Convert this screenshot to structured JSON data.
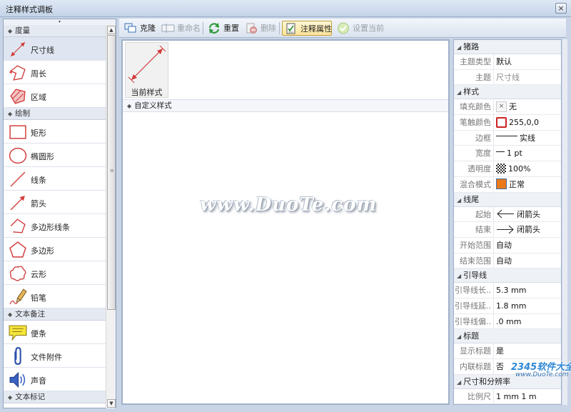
{
  "window": {
    "title": "注释样式调板",
    "close_glyph": "×"
  },
  "left_panel": {
    "groups": [
      {
        "label": "度量",
        "items": [
          {
            "label": "尺寸线",
            "icon": "dimension-line-icon",
            "selected": true
          },
          {
            "label": "周长",
            "icon": "perimeter-icon"
          },
          {
            "label": "区域",
            "icon": "area-icon"
          }
        ]
      },
      {
        "label": "绘制",
        "items": [
          {
            "label": "矩形",
            "icon": "rectangle-icon"
          },
          {
            "label": "椭圆形",
            "icon": "ellipse-icon"
          },
          {
            "label": "线条",
            "icon": "line-icon"
          },
          {
            "label": "箭头",
            "icon": "arrow-icon"
          },
          {
            "label": "多边形线条",
            "icon": "polyline-icon"
          },
          {
            "label": "多边形",
            "icon": "polygon-icon"
          },
          {
            "label": "云形",
            "icon": "cloud-icon"
          },
          {
            "label": "铅笔",
            "icon": "pencil-icon"
          }
        ]
      },
      {
        "label": "文本备注",
        "items": [
          {
            "label": "便条",
            "icon": "sticky-note-icon"
          },
          {
            "label": "文件附件",
            "icon": "paperclip-icon"
          },
          {
            "label": "声音",
            "icon": "speaker-icon"
          }
        ]
      },
      {
        "label": "文本标记",
        "items": []
      }
    ]
  },
  "toolbar": {
    "clone": "克隆",
    "rename": "重命名",
    "reset": "重置",
    "delete": "删除",
    "annotation_props": "注释属性",
    "set_current": "设置当前"
  },
  "center": {
    "current_style_label": "当前样式",
    "custom_styles_header": "自定义样式",
    "watermark": "www.DuoTe.com"
  },
  "properties": {
    "sections": [
      {
        "label": "猪路",
        "rows": [
          {
            "key": "主题类型",
            "value": "默认"
          },
          {
            "key": "主题",
            "value": "尺寸线",
            "gray": true
          }
        ]
      },
      {
        "label": "样式",
        "rows": [
          {
            "key": "填充颜色",
            "value": "无",
            "swatch": "none"
          },
          {
            "key": "笔触颜色",
            "value": "255,0,0",
            "swatch": "#cc2222"
          },
          {
            "key": "边框",
            "value": "实线",
            "swatch": "solid-line"
          },
          {
            "key": "宽度",
            "value": "1 pt",
            "swatch": "thin-line"
          },
          {
            "key": "透明度",
            "value": "100%",
            "swatch": "checker"
          },
          {
            "key": "混合模式",
            "value": "正常",
            "swatch": "#e87a1a"
          }
        ]
      },
      {
        "label": "线尾",
        "rows": [
          {
            "key": "起始",
            "value": "闭箭头",
            "swatch": "arrow-left"
          },
          {
            "key": "结束",
            "value": "闭箭头",
            "swatch": "arrow-right"
          },
          {
            "key": "开始范围",
            "value": "自动"
          },
          {
            "key": "结束范围",
            "value": "自动"
          }
        ]
      },
      {
        "label": "引导线",
        "rows": [
          {
            "key": "引导线长..",
            "value": "5.3 mm"
          },
          {
            "key": "引导线延..",
            "value": "1.8 mm"
          },
          {
            "key": "引导线偏..",
            "value": ".0 mm"
          }
        ]
      },
      {
        "label": "标题",
        "rows": [
          {
            "key": "显示标题",
            "value": "是"
          },
          {
            "key": "内联标题",
            "value": "否"
          }
        ]
      },
      {
        "label": "尺寸和分辨率",
        "rows": [
          {
            "key": "比例尺",
            "value": "1 mm        1 m"
          }
        ]
      }
    ]
  },
  "overlay_logo": {
    "name": "2345软件大全",
    "url": "www.DuoTe.com"
  },
  "colors": {
    "accent_red": "#cc2222",
    "panel_border": "#9fb0c8"
  }
}
